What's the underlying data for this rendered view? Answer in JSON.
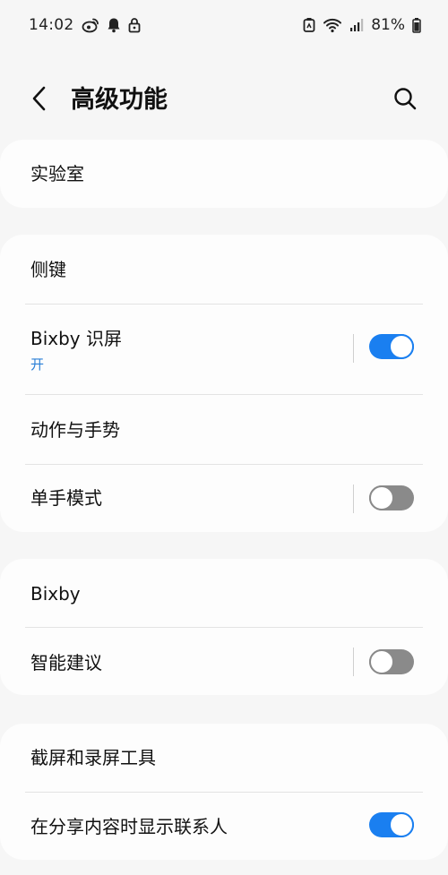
{
  "status_bar": {
    "time": "14:02",
    "battery_percent": "81%",
    "left_icons": [
      "weibo-icon",
      "bell-icon",
      "lock-icon"
    ],
    "right_icons": [
      "nfc-icon",
      "wifi-icon",
      "signal-icon",
      "battery-icon"
    ]
  },
  "header": {
    "title": "高级功能"
  },
  "sections": [
    {
      "items": [
        {
          "label": "实验室"
        }
      ]
    },
    {
      "items": [
        {
          "label": "侧键"
        },
        {
          "label": "Bixby 识屏",
          "sub": "开",
          "toggle": true
        },
        {
          "label": "动作与手势"
        },
        {
          "label": "单手模式",
          "toggle": false
        }
      ]
    },
    {
      "items": [
        {
          "label": "Bixby"
        },
        {
          "label": "智能建议",
          "toggle": false
        }
      ]
    },
    {
      "items": [
        {
          "label": "截屏和录屏工具"
        },
        {
          "label": "在分享内容时显示联系人",
          "toggle": true
        }
      ]
    }
  ],
  "colors": {
    "accent": "#1a7ff0",
    "toggle_off": "#8a8a8a",
    "subtext": "#2a7fd6",
    "background": "#f6f6f6",
    "card": "#fdfdfd"
  }
}
